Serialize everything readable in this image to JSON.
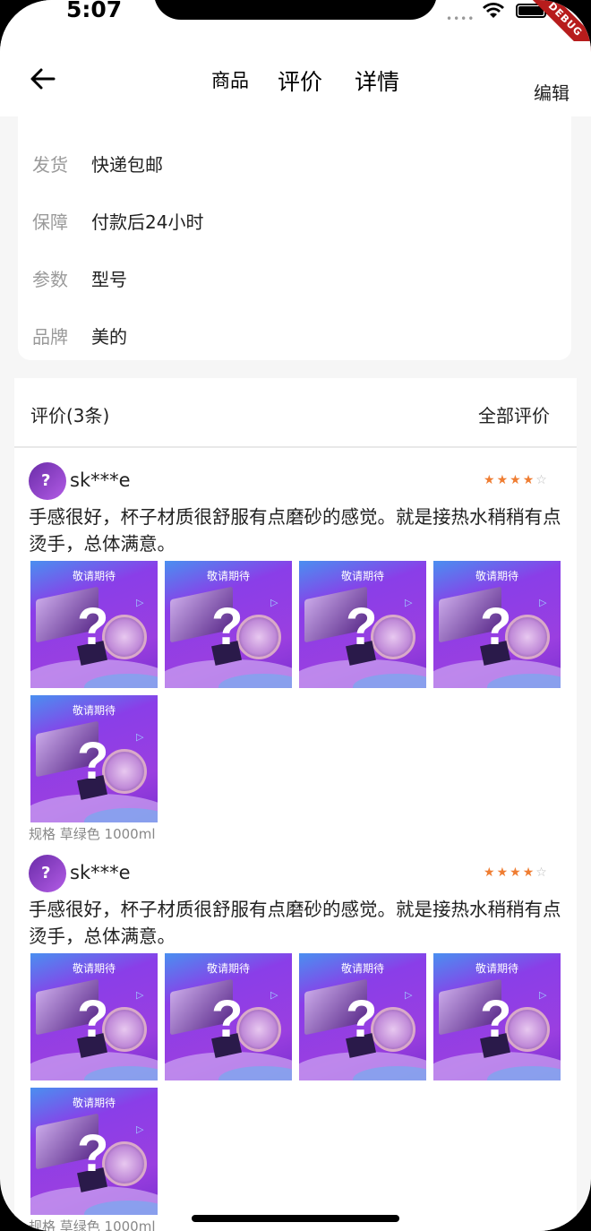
{
  "status_bar": {
    "time": "5:07",
    "signal": "••••",
    "debug_banner": "DEBUG"
  },
  "app_bar": {
    "tabs": [
      {
        "label": "商品"
      },
      {
        "label": "评价"
      },
      {
        "label": "详情"
      }
    ],
    "edit_label": "编辑"
  },
  "info": {
    "rows": [
      {
        "label": "发货",
        "value": "快递包邮"
      },
      {
        "label": "保障",
        "value": "付款后24小时"
      },
      {
        "label": "参数",
        "value": "型号"
      },
      {
        "label": "品牌",
        "value": "美的"
      }
    ]
  },
  "reviews": {
    "header": "评价(3条)",
    "all_label": "全部评价",
    "photo_title": "敬请期待",
    "items": [
      {
        "username": "sk***e",
        "rating": 4,
        "max_rating": 5,
        "text": "手感很好，杯子材质很舒服有点磨砂的感觉。就是接热水稍稍有点烫手，总体满意。",
        "photo_count": 5,
        "spec": "规格 草绿色 1000ml"
      },
      {
        "username": "sk***e",
        "rating": 4,
        "max_rating": 5,
        "text": "手感很好，杯子材质很舒服有点磨砂的感觉。就是接热水稍稍有点烫手，总体满意。",
        "photo_count": 5,
        "spec": "规格 草绿色 1000ml"
      }
    ]
  },
  "colors": {
    "star": "#ef7d32",
    "photo_accent": "#9a3fe0",
    "debug": "#b71c1c"
  }
}
